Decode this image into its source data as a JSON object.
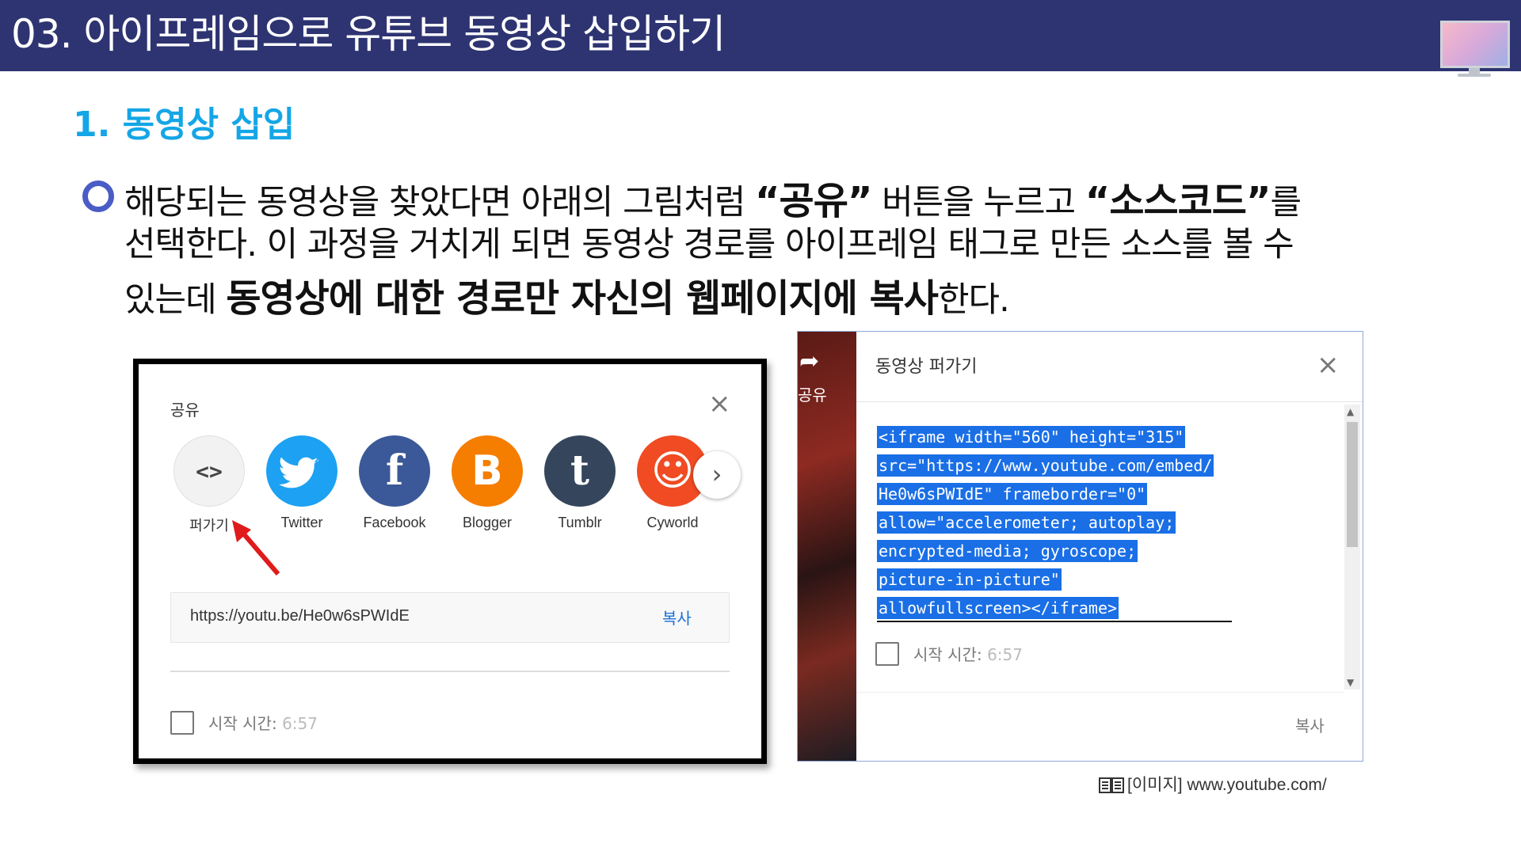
{
  "header": {
    "title": "03. 아이프레임으로 유튜브 동영상 삽입하기",
    "bg_color": "#2e3471"
  },
  "subtitle": "1. 동영상 삽입",
  "paragraph": {
    "l1_a": "해당되는 동영상을 찾았다면 아래의 그림처럼 ",
    "l1_b": "“공유”",
    "l1_c": " 버튼을 누르고 ",
    "l1_d": "“소스코드”",
    "l1_e": "를",
    "l2": "선택한다. 이 과정을 거치게 되면 동영상 경로를 아이프레임 태그로 만든 소스를 볼 수",
    "l3_a": "있는데 ",
    "l3_b": "동영상에 대한 경로만 자신의 웹페이지에 복사",
    "l3_c": "한다."
  },
  "share_dialog": {
    "title": "공유",
    "close": "×",
    "items": [
      {
        "label": "퍼가기",
        "icon": "code-icon",
        "color": "#f2f2f2",
        "glyph": "<>"
      },
      {
        "label": "Twitter",
        "icon": "twitter-icon",
        "color": "#1da1f2",
        "glyph": ""
      },
      {
        "label": "Facebook",
        "icon": "facebook-icon",
        "color": "#3b5998",
        "glyph": "f"
      },
      {
        "label": "Blogger",
        "icon": "blogger-icon",
        "color": "#f57d00",
        "glyph": "B"
      },
      {
        "label": "Tumblr",
        "icon": "tumblr-icon",
        "color": "#35465c",
        "glyph": "t"
      },
      {
        "label": "Cyworld",
        "icon": "cyworld-icon",
        "color": "#f04b23",
        "glyph": "☺"
      }
    ],
    "next": "›",
    "url": "https://youtu.be/He0w6sPWIdE",
    "copy": "복사",
    "start_label": "시작 시간:",
    "start_time": "6:57"
  },
  "embed_dialog": {
    "side_label": "공유",
    "title": "동영상 퍼가기",
    "close": "×",
    "code_lines": [
      "<iframe width=\"560\" height=\"315\"",
      "src=\"https://www.youtube.com/embed/",
      "He0w6sPWIdE\" frameborder=\"0\"",
      "allow=\"accelerometer; autoplay;",
      "encrypted-media; gyroscope;",
      "picture-in-picture\"",
      "allowfullscreen></iframe>"
    ],
    "start_label": "시작 시간:",
    "start_time": "6:57",
    "copy": "복사"
  },
  "caption": {
    "label": "[이미지]",
    "source": "www.youtube.com/"
  }
}
